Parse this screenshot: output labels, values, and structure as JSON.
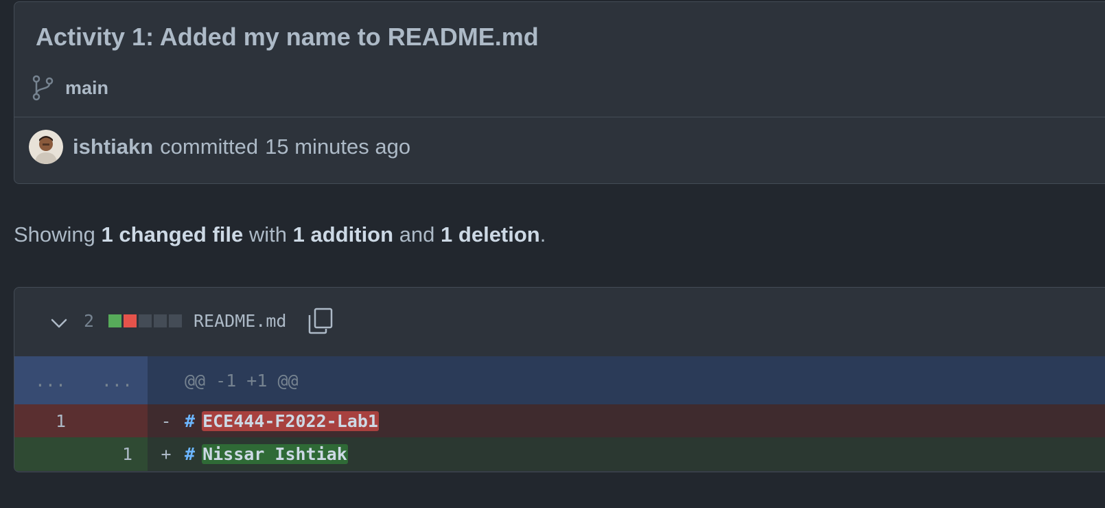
{
  "commit": {
    "title": "Activity 1: Added my name to README.md",
    "branch": "main",
    "author": "ishtiakn",
    "verb": "committed",
    "time": "15 minutes ago"
  },
  "summary": {
    "prefix": "Showing",
    "files": "1 changed file",
    "with": "with",
    "additions": "1 addition",
    "and": "and",
    "deletions": "1 deletion",
    "suffix": "."
  },
  "file": {
    "change_count": "2",
    "name": "README.md",
    "diffstat": [
      "add",
      "del",
      "neu",
      "neu",
      "neu"
    ],
    "hunk": {
      "old": "...",
      "new": "...",
      "header": "@@ -1 +1 @@"
    },
    "lines": [
      {
        "type": "del",
        "old": "1",
        "new": "",
        "marker": "-",
        "hash": "#",
        "text": "ECE444-F2022-Lab1"
      },
      {
        "type": "add",
        "old": "",
        "new": "1",
        "marker": "+",
        "hash": "#",
        "text": "Nissar Ishtiak"
      }
    ]
  },
  "colors": {
    "background": "#22272e",
    "addition": "#57ab5a",
    "deletion": "#e5534b",
    "hunk": "#2b3b58"
  }
}
